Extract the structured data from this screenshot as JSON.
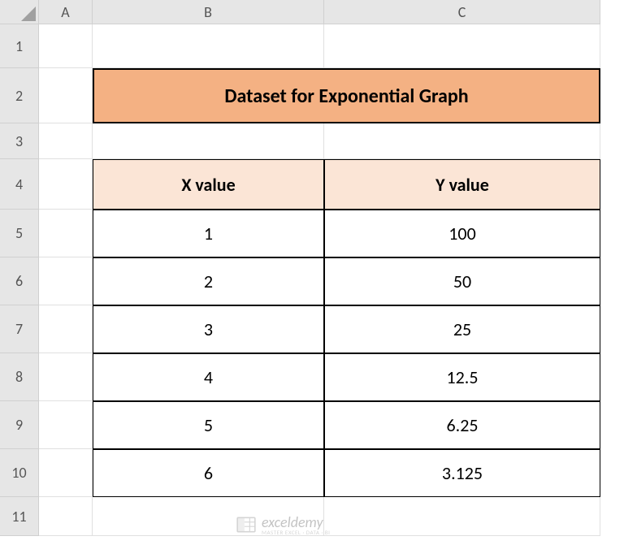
{
  "columns": [
    "A",
    "B",
    "C"
  ],
  "rows": [
    "1",
    "2",
    "3",
    "4",
    "5",
    "6",
    "7",
    "8",
    "9",
    "10",
    "11"
  ],
  "title": "Dataset for Exponential Graph",
  "table": {
    "headers": [
      "X value",
      "Y value"
    ],
    "data": [
      {
        "x": "1",
        "y": "100"
      },
      {
        "x": "2",
        "y": "50"
      },
      {
        "x": "3",
        "y": "25"
      },
      {
        "x": "4",
        "y": "12.5"
      },
      {
        "x": "5",
        "y": "6.25"
      },
      {
        "x": "6",
        "y": "3.125"
      }
    ]
  },
  "watermark": {
    "main": "exceldemy",
    "sub": "MASTER EXCEL · DATA · BI"
  },
  "chart_data": {
    "type": "table",
    "title": "Dataset for Exponential Graph",
    "series": [
      {
        "name": "X value",
        "values": [
          1,
          2,
          3,
          4,
          5,
          6
        ]
      },
      {
        "name": "Y value",
        "values": [
          100,
          50,
          25,
          12.5,
          6.25,
          3.125
        ]
      }
    ]
  }
}
